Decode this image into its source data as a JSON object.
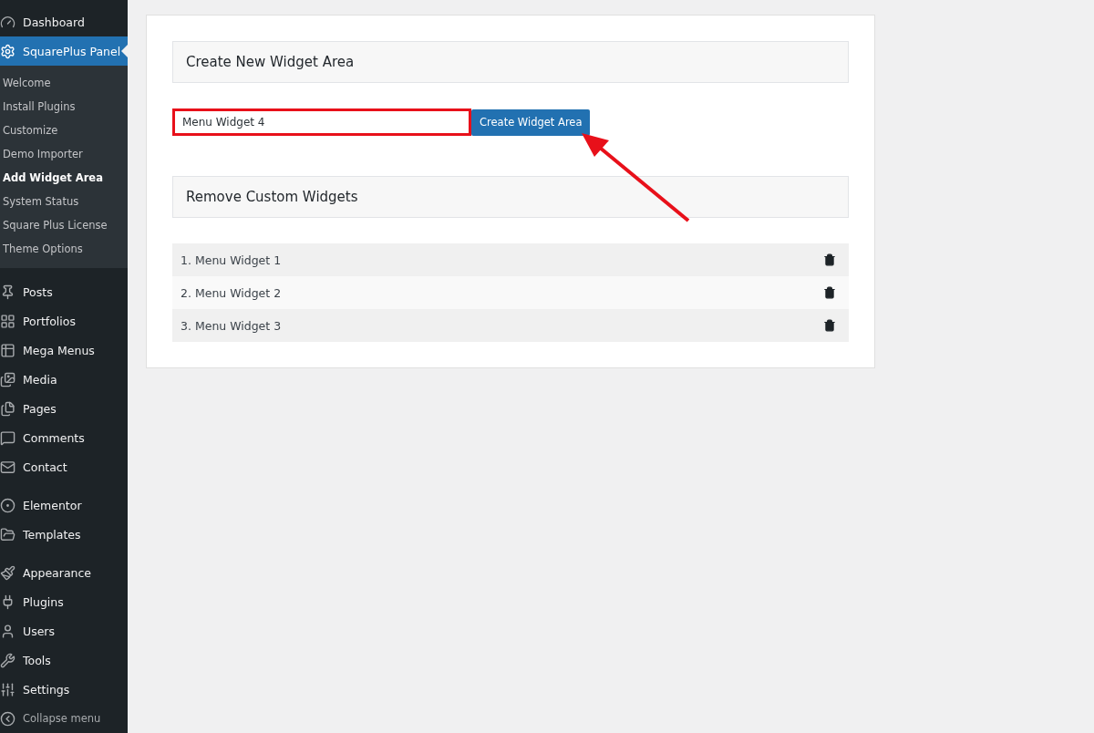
{
  "sidebar": {
    "menu_groups": [
      [
        {
          "label": "Dashboard",
          "selected": false
        },
        {
          "label": "SquarePlus Panel",
          "selected": true,
          "submenu": [
            {
              "label": "Welcome",
              "selected": false
            },
            {
              "label": "Install Plugins",
              "selected": false
            },
            {
              "label": "Customize",
              "selected": false
            },
            {
              "label": "Demo Importer",
              "selected": false
            },
            {
              "label": "Add Widget Area",
              "selected": true
            },
            {
              "label": "System Status",
              "selected": false
            },
            {
              "label": "Square Plus License",
              "selected": false
            },
            {
              "label": "Theme Options",
              "selected": false
            }
          ]
        }
      ],
      [
        {
          "label": "Posts",
          "selected": false
        },
        {
          "label": "Portfolios",
          "selected": false
        },
        {
          "label": "Mega Menus",
          "selected": false
        },
        {
          "label": "Media",
          "selected": false
        },
        {
          "label": "Pages",
          "selected": false
        },
        {
          "label": "Comments",
          "selected": false
        },
        {
          "label": "Contact",
          "selected": false
        }
      ],
      [
        {
          "label": "Elementor",
          "selected": false
        },
        {
          "label": "Templates",
          "selected": false
        }
      ],
      [
        {
          "label": "Appearance",
          "selected": false
        },
        {
          "label": "Plugins",
          "selected": false
        },
        {
          "label": "Users",
          "selected": false
        },
        {
          "label": "Tools",
          "selected": false
        },
        {
          "label": "Settings",
          "selected": false
        }
      ]
    ],
    "collapse": "Collapse menu"
  },
  "create_section": {
    "title": "Create New Widget Area",
    "input_value": "Menu Widget 4",
    "button": "Create Widget Area"
  },
  "remove_section": {
    "title": "Remove Custom Widgets",
    "widgets": [
      "1. Menu Widget 1",
      "2. Menu Widget 2",
      "3. Menu Widget 3"
    ]
  }
}
